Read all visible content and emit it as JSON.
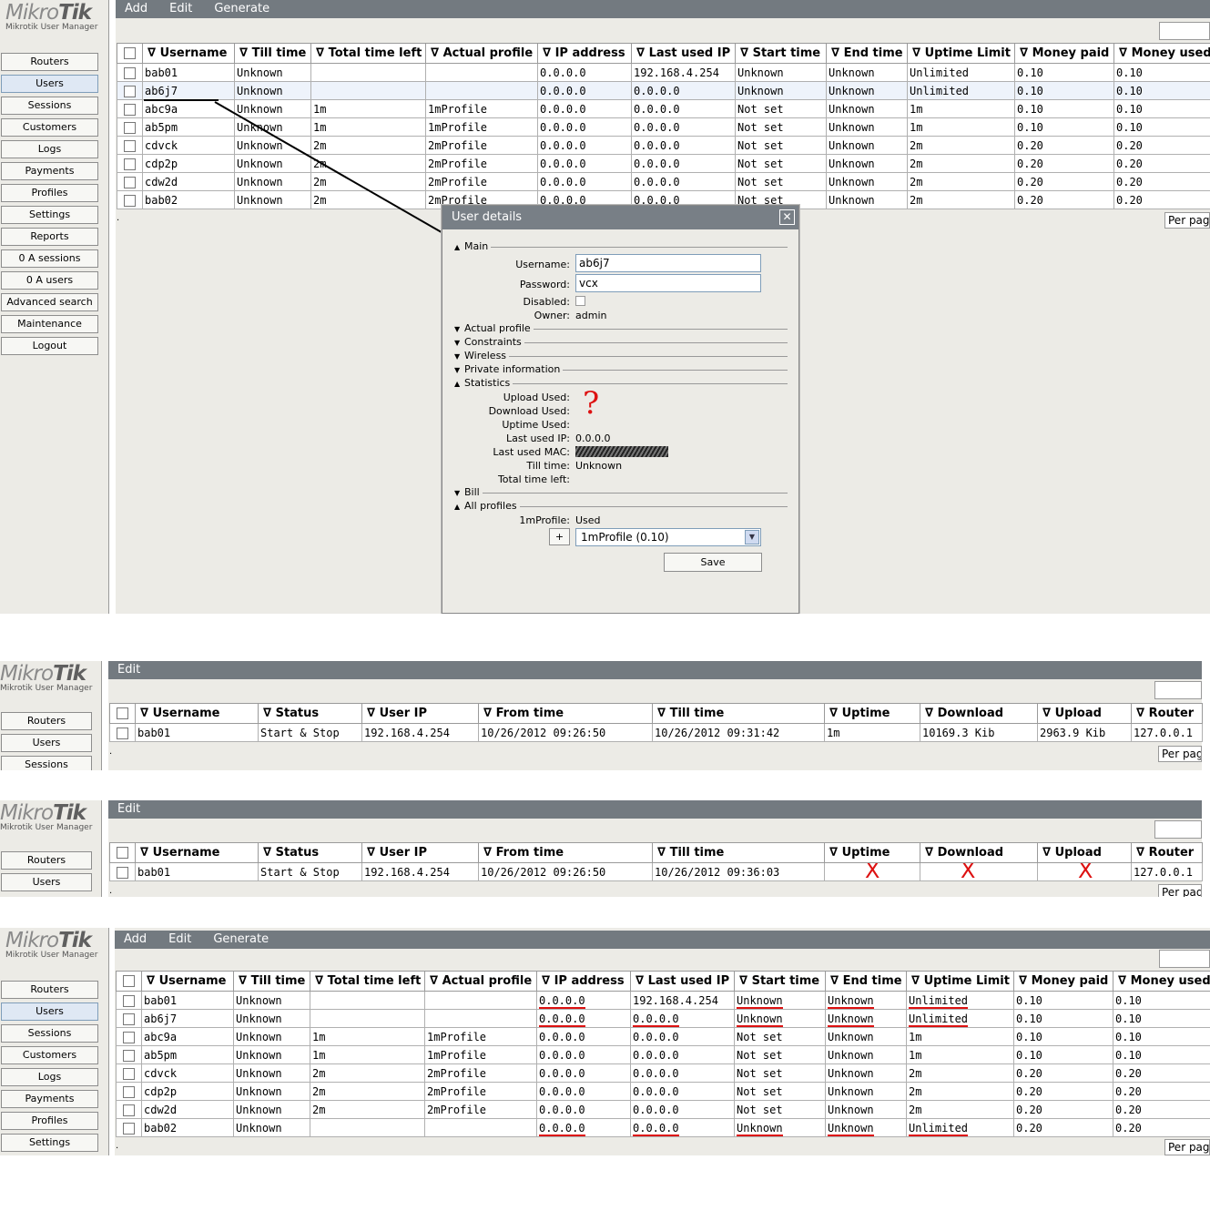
{
  "logo": {
    "brand_a": "Mikro",
    "brand_b": "Tik",
    "sub": "Mikrotik User Manager"
  },
  "sidebar": {
    "items": [
      "Routers",
      "Users",
      "Sessions",
      "Customers",
      "Logs",
      "Payments",
      "Profiles",
      "Settings",
      "Reports",
      "0 A sessions",
      "0 A users",
      "Advanced search",
      "Maintenance",
      "Logout"
    ],
    "active": "Users"
  },
  "users_toolbar": [
    "Add",
    "Edit",
    "Generate"
  ],
  "sessions_toolbar": [
    "Edit"
  ],
  "users_columns": [
    "∇ Username",
    "∇ Till time",
    "∇ Total time left",
    "∇ Actual profile",
    "∇ IP address",
    "∇ Last used IP",
    "∇ Start time",
    "∇ End time",
    "∇ Uptime Limit",
    "∇ Money paid",
    "∇ Money used"
  ],
  "users_rows": [
    [
      "bab01",
      "Unknown",
      "",
      "",
      "0.0.0.0",
      "192.168.4.254",
      "Unknown",
      "Unknown",
      "Unlimited",
      "0.10",
      "0.10"
    ],
    [
      "ab6j7",
      "Unknown",
      "",
      "",
      "0.0.0.0",
      "0.0.0.0",
      "Unknown",
      "Unknown",
      "Unlimited",
      "0.10",
      "0.10"
    ],
    [
      "abc9a",
      "Unknown",
      "1m",
      "1mProfile",
      "0.0.0.0",
      "0.0.0.0",
      "Not set",
      "Unknown",
      "1m",
      "0.10",
      "0.10"
    ],
    [
      "ab5pm",
      "Unknown",
      "1m",
      "1mProfile",
      "0.0.0.0",
      "0.0.0.0",
      "Not set",
      "Unknown",
      "1m",
      "0.10",
      "0.10"
    ],
    [
      "cdvck",
      "Unknown",
      "2m",
      "2mProfile",
      "0.0.0.0",
      "0.0.0.0",
      "Not set",
      "Unknown",
      "2m",
      "0.20",
      "0.20"
    ],
    [
      "cdp2p",
      "Unknown",
      "2m",
      "2mProfile",
      "0.0.0.0",
      "0.0.0.0",
      "Not set",
      "Unknown",
      "2m",
      "0.20",
      "0.20"
    ],
    [
      "cdw2d",
      "Unknown",
      "2m",
      "2mProfile",
      "0.0.0.0",
      "0.0.0.0",
      "Not set",
      "Unknown",
      "2m",
      "0.20",
      "0.20"
    ],
    [
      "bab02",
      "Unknown",
      "2m",
      "2mProfile",
      "0.0.0.0",
      "0.0.0.0",
      "Not set",
      "Unknown",
      "2m",
      "0.20",
      "0.20"
    ]
  ],
  "users_rows_bottom": [
    [
      "bab01",
      "Unknown",
      "",
      "",
      "0.0.0.0",
      "192.168.4.254",
      "Unknown",
      "Unknown",
      "Unlimited",
      "0.10",
      "0.10"
    ],
    [
      "ab6j7",
      "Unknown",
      "",
      "",
      "0.0.0.0",
      "0.0.0.0",
      "Unknown",
      "Unknown",
      "Unlimited",
      "0.10",
      "0.10"
    ],
    [
      "abc9a",
      "Unknown",
      "1m",
      "1mProfile",
      "0.0.0.0",
      "0.0.0.0",
      "Not set",
      "Unknown",
      "1m",
      "0.10",
      "0.10"
    ],
    [
      "ab5pm",
      "Unknown",
      "1m",
      "1mProfile",
      "0.0.0.0",
      "0.0.0.0",
      "Not set",
      "Unknown",
      "1m",
      "0.10",
      "0.10"
    ],
    [
      "cdvck",
      "Unknown",
      "2m",
      "2mProfile",
      "0.0.0.0",
      "0.0.0.0",
      "Not set",
      "Unknown",
      "2m",
      "0.20",
      "0.20"
    ],
    [
      "cdp2p",
      "Unknown",
      "2m",
      "2mProfile",
      "0.0.0.0",
      "0.0.0.0",
      "Not set",
      "Unknown",
      "2m",
      "0.20",
      "0.20"
    ],
    [
      "cdw2d",
      "Unknown",
      "2m",
      "2mProfile",
      "0.0.0.0",
      "0.0.0.0",
      "Not set",
      "Unknown",
      "2m",
      "0.20",
      "0.20"
    ],
    [
      "bab02",
      "Unknown",
      "",
      "",
      "0.0.0.0",
      "0.0.0.0",
      "Unknown",
      "Unknown",
      "Unlimited",
      "0.20",
      "0.20"
    ]
  ],
  "sessions_columns": [
    "∇ Username",
    "∇ Status",
    "∇ User IP",
    "∇ From time",
    "∇ Till time",
    "∇ Uptime",
    "∇ Download",
    "∇ Upload",
    "∇ Router"
  ],
  "sessions_row_a": [
    "bab01",
    "Start & Stop",
    "192.168.4.254",
    "10/26/2012 09:26:50",
    "10/26/2012 09:31:42",
    "1m",
    "10169.3 Kib",
    "2963.9 Kib",
    "127.0.0.1"
  ],
  "sessions_row_b": [
    "bab01",
    "Start & Stop",
    "192.168.4.254",
    "10/26/2012 09:26:50",
    "10/26/2012 09:36:03",
    "",
    "",
    "",
    "127.0.0.1"
  ],
  "per_page": "Per page",
  "dialog": {
    "title": "User details",
    "sections": {
      "main": "Main",
      "actual_profile": "Actual profile",
      "constraints": "Constraints",
      "wireless": "Wireless",
      "private_info": "Private information",
      "statistics": "Statistics",
      "bill": "Bill",
      "all_profiles": "All profiles"
    },
    "labels": {
      "username": "Username:",
      "password": "Password:",
      "disabled": "Disabled:",
      "owner": "Owner:",
      "upload_used": "Upload Used:",
      "download_used": "Download Used:",
      "uptime_used": "Uptime Used:",
      "last_ip": "Last used IP:",
      "last_mac": "Last used MAC:",
      "till_time": "Till time:",
      "total_left": "Total time left:",
      "profile_1m": "1mProfile:"
    },
    "values": {
      "username": "ab6j7",
      "password": "vcx",
      "owner": "admin",
      "last_ip": "0.0.0.0",
      "till_time": "Unknown",
      "profile_1m": "Used",
      "profile_select": "1mProfile (0.10)"
    },
    "plus": "+",
    "save": "Save",
    "question": "?"
  },
  "marks": {
    "x": "X"
  }
}
